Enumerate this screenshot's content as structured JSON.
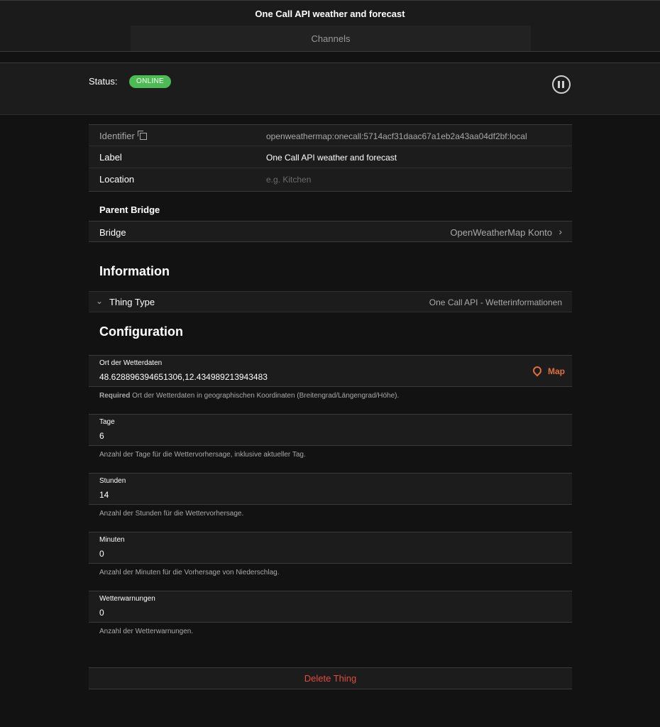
{
  "header": {
    "title": "One Call API weather and forecast"
  },
  "tabs": [
    {
      "label": "Channels"
    }
  ],
  "status": {
    "label": "Status:",
    "badge": "ONLINE",
    "badge_color": "#4cbb53"
  },
  "details": {
    "identifier": {
      "label": "Identifier",
      "value": "openweathermap:onecall:5714acf31daac67a1eb2a43aa04df2bf:local"
    },
    "label": {
      "label": "Label",
      "value": "One Call API weather and forecast"
    },
    "location": {
      "label": "Location",
      "placeholder": "e.g. Kitchen"
    }
  },
  "parent_bridge": {
    "heading": "Parent Bridge",
    "label": "Bridge",
    "value": "OpenWeatherMap Konto"
  },
  "information": {
    "heading": "Information",
    "thing_type_label": "Thing Type",
    "thing_type_value": "One Call API - Wetterinformationen"
  },
  "configuration": {
    "heading": "Configuration",
    "map_label": "Map",
    "required_label": "Required",
    "fields": [
      {
        "label": "Ort der Wetterdaten",
        "value": "48.628896394651306,12.434989213943483",
        "help": "Ort der Wetterdaten in geographischen Koordinaten (Breitengrad/Längengrad/Höhe)."
      },
      {
        "label": "Tage",
        "value": "6",
        "help": "Anzahl der Tage für die Wettervorhersage, inklusive aktueller Tag."
      },
      {
        "label": "Stunden",
        "value": "14",
        "help": "Anzahl der Stunden für die Wettervorhersage."
      },
      {
        "label": "Minuten",
        "value": "0",
        "help": "Anzahl der Minuten für die Vorhersage von Niederschlag."
      },
      {
        "label": "Wetterwarnungen",
        "value": "0",
        "help": "Anzahl der Wetterwarnungen."
      }
    ]
  },
  "actions": {
    "delete_label": "Delete Thing",
    "delete_color": "#e34c3f",
    "accent_color": "#e0703d"
  },
  "icons": [
    "pause-icon",
    "copy-icon",
    "chevron-right-icon",
    "chevron-down-icon",
    "map-pin-icon"
  ]
}
